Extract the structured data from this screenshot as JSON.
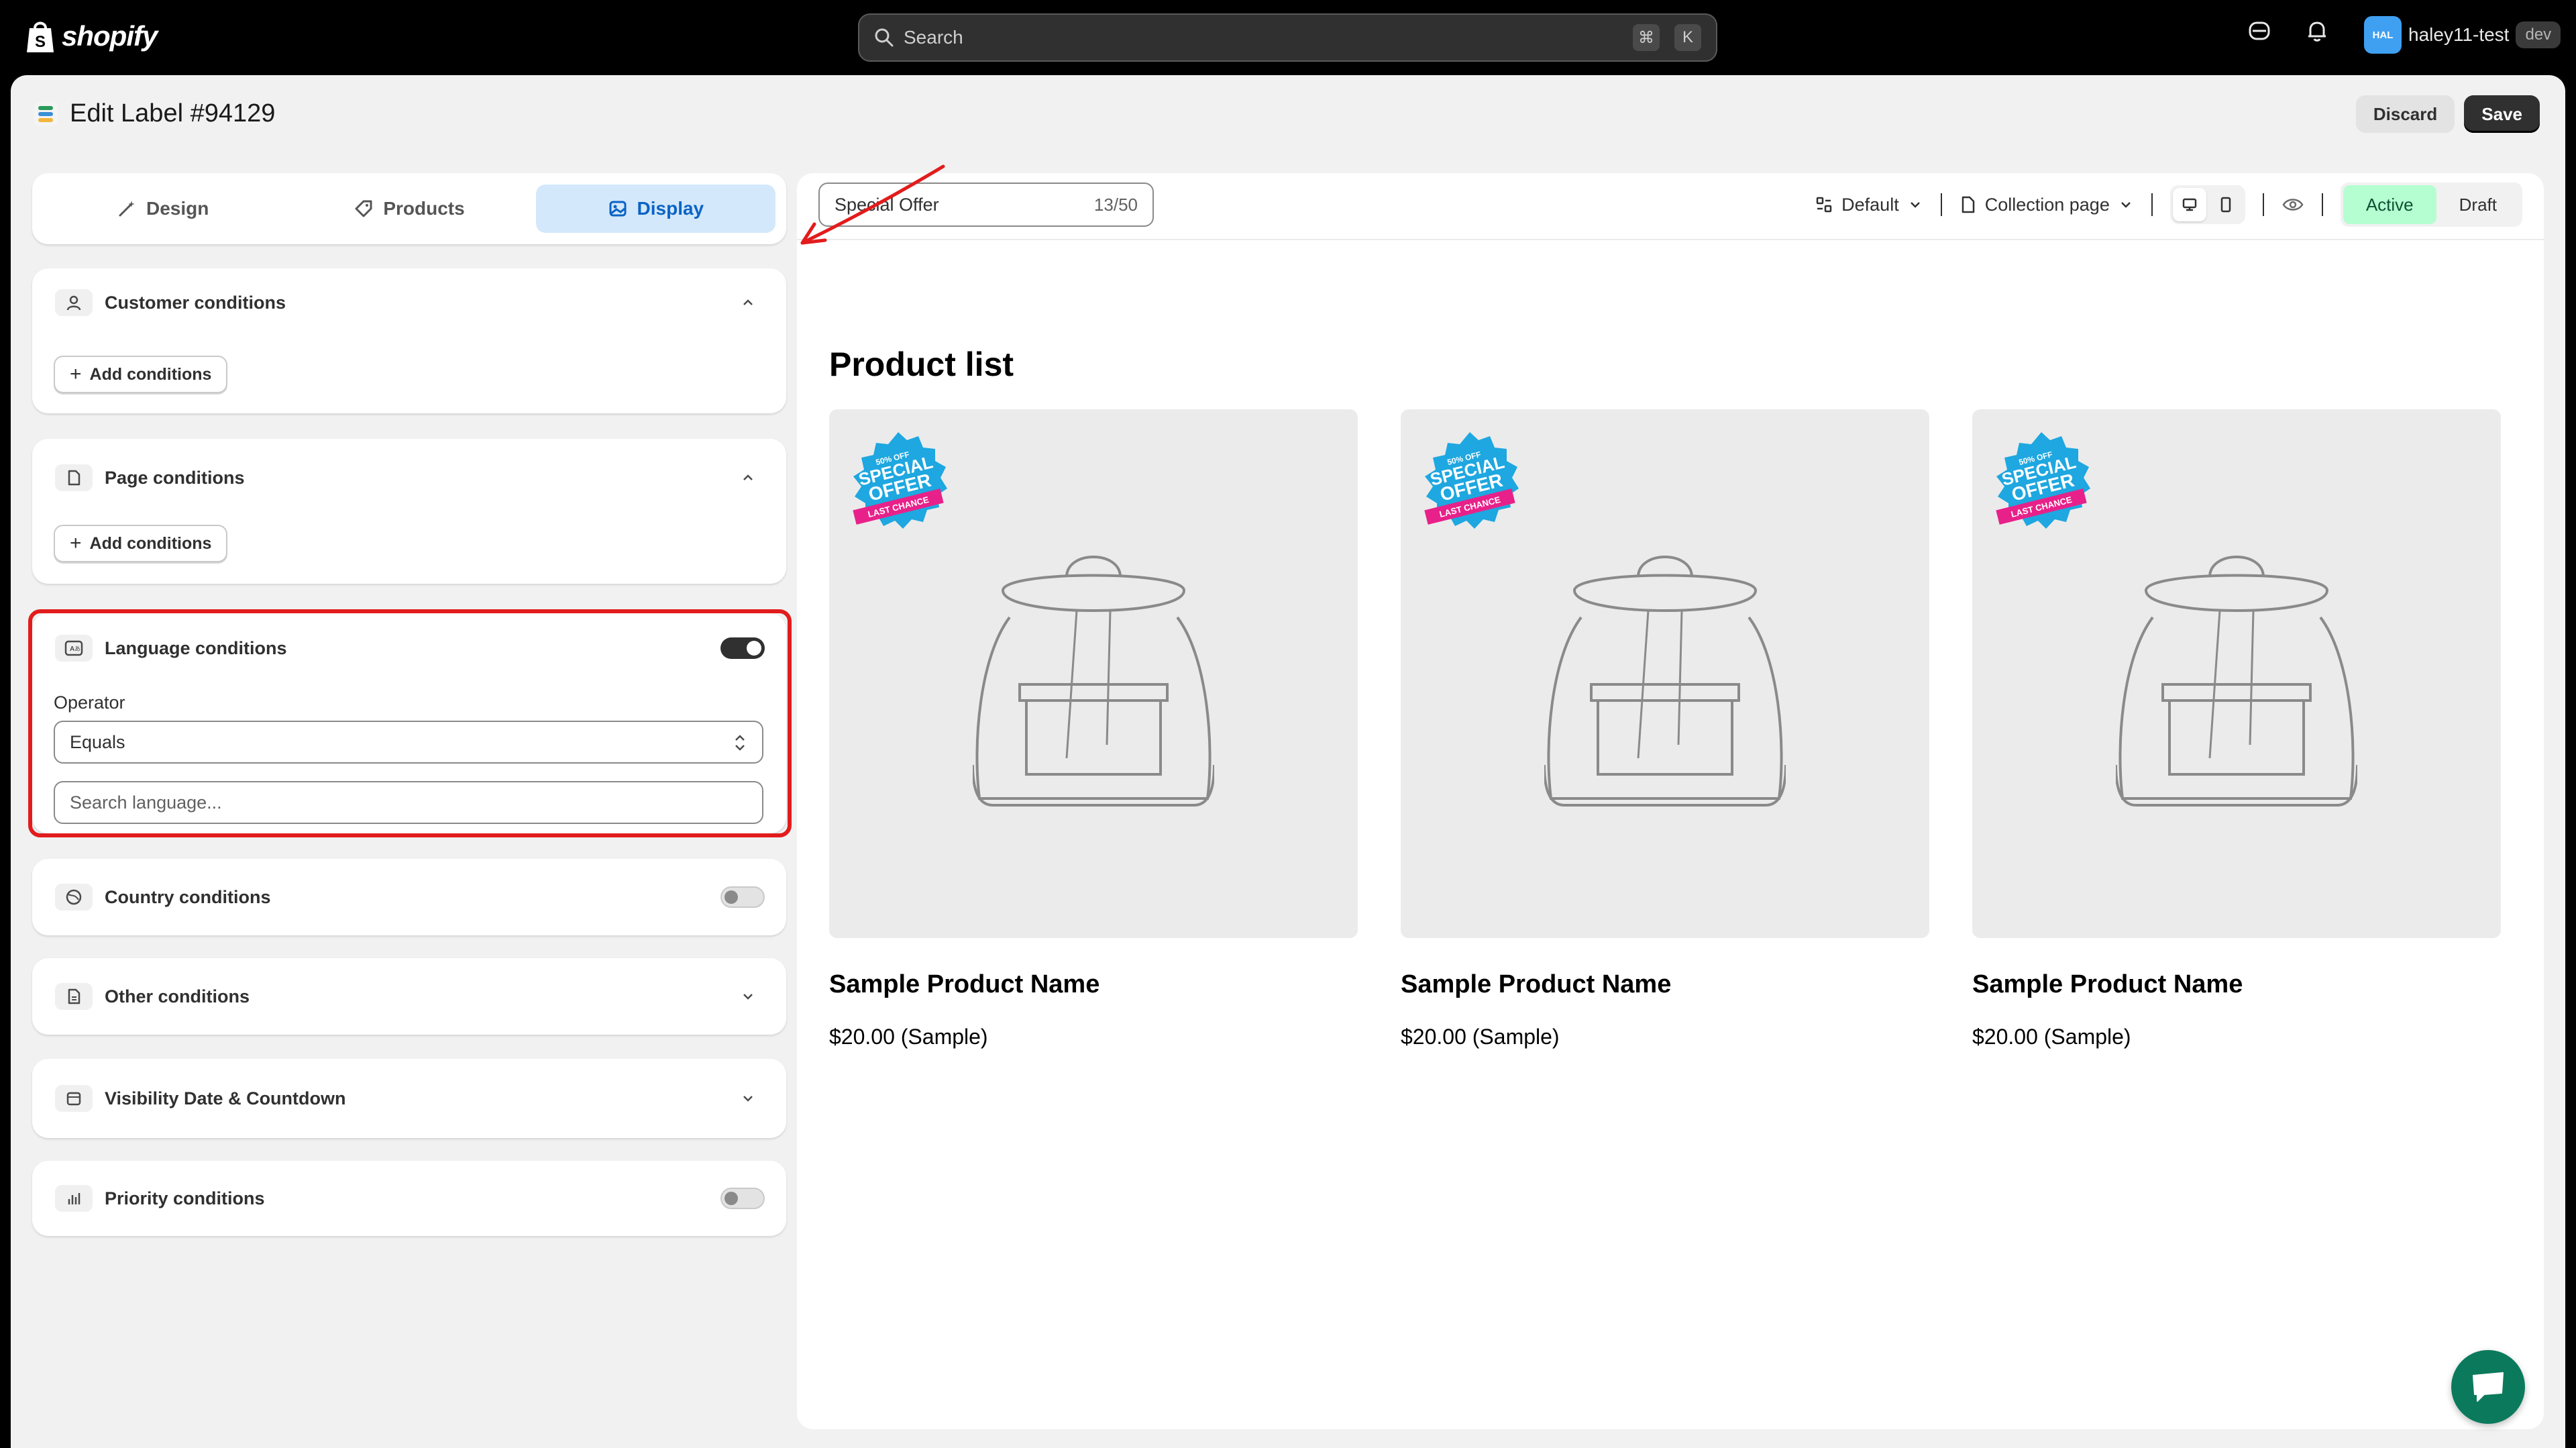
{
  "topbar": {
    "logo_text": "shopify",
    "search_placeholder": "Search",
    "shortcut_keys": [
      "⌘",
      "K"
    ],
    "account_initials": "HAL",
    "account_name": "haley11-test",
    "account_badge": "dev"
  },
  "header": {
    "title": "Edit Label #94129",
    "discard_label": "Discard",
    "save_label": "Save"
  },
  "tabs": [
    {
      "label": "Design",
      "icon": "magic-wand-icon",
      "active": false
    },
    {
      "label": "Products",
      "icon": "tag-icon",
      "active": false
    },
    {
      "label": "Display",
      "icon": "image-icon",
      "active": true
    }
  ],
  "conditions": {
    "customer": {
      "title": "Customer conditions",
      "add_label": "Add conditions"
    },
    "page": {
      "title": "Page conditions",
      "add_label": "Add conditions"
    },
    "language": {
      "title": "Language conditions",
      "enabled": true,
      "operator_label": "Operator",
      "operator_value": "Equals",
      "search_placeholder": "Search language..."
    },
    "country": {
      "title": "Country conditions",
      "enabled": false
    },
    "other": {
      "title": "Other conditions"
    },
    "visibility": {
      "title": "Visibility Date & Countdown"
    },
    "priority": {
      "title": "Priority conditions",
      "enabled": false
    }
  },
  "preview": {
    "label_name": "Special Offer",
    "char_count": "13/50",
    "template_dropdown": "Default",
    "page_dropdown": "Collection page",
    "status_active": "Active",
    "status_draft": "Draft",
    "list_title": "Product list",
    "products": [
      {
        "name": "Sample Product Name",
        "price": "$20.00 (Sample)"
      },
      {
        "name": "Sample Product Name",
        "price": "$20.00 (Sample)"
      },
      {
        "name": "Sample Product Name",
        "price": "$20.00 (Sample)"
      }
    ],
    "badge": {
      "top": "50% OFF",
      "main1": "SPECIAL",
      "main2": "OFFER",
      "ribbon": "LAST CHANCE"
    }
  },
  "colors": {
    "active_tab_bg": "#d3e8fb",
    "active_tab_text": "#0b63c5",
    "highlight_border": "#e21c1c",
    "status_active_bg": "#b4fed2",
    "chat_fab": "#0b7a5c"
  }
}
